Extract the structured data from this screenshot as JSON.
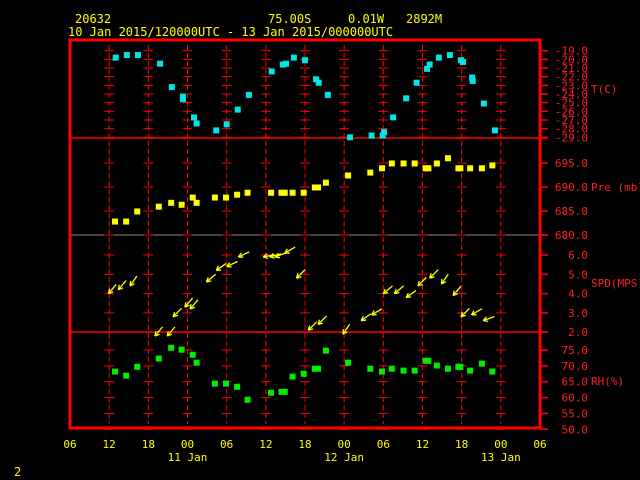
{
  "header": {
    "station": "20632",
    "lat": "75.00S",
    "lon": "0.01W",
    "elev": "2892M",
    "period": "10 Jan 2015/120000UTC - 13 Jan 2015/000000UTC"
  },
  "footer_label": "2",
  "colors": {
    "frame": "#ff0000",
    "text": "#ffff00",
    "temp": "#00e5e5",
    "pres": "#ffff00",
    "wind": "#ffff00",
    "rh": "#00ee00",
    "axis_label": "#ff2020"
  },
  "chart_data": {
    "type": "scatter",
    "x_unit": "hours since 10 Jan 2015 06 UTC",
    "xlim": [
      0,
      72
    ],
    "x_ticks": [
      {
        "h": 0,
        "label": "06"
      },
      {
        "h": 6,
        "label": "12"
      },
      {
        "h": 12,
        "label": "18"
      },
      {
        "h": 18,
        "label": "00"
      },
      {
        "h": 24,
        "label": "06"
      },
      {
        "h": 30,
        "label": "12"
      },
      {
        "h": 36,
        "label": "18"
      },
      {
        "h": 42,
        "label": "00"
      },
      {
        "h": 48,
        "label": "06"
      },
      {
        "h": 54,
        "label": "12"
      },
      {
        "h": 60,
        "label": "18"
      },
      {
        "h": 66,
        "label": "00"
      },
      {
        "h": 72,
        "label": "06"
      }
    ],
    "date_labels": [
      {
        "h": 18,
        "label": "11 Jan"
      },
      {
        "h": 42,
        "label": "12 Jan"
      },
      {
        "h": 66,
        "label": "13 Jan"
      }
    ],
    "panels": [
      {
        "name": "temperature",
        "label": "T(C)",
        "ylim": [
          -29,
          -19
        ],
        "ticks": [
          {
            "v": -19,
            "label": "-19.0"
          },
          {
            "v": -20,
            "label": "-20.0"
          },
          {
            "v": -21,
            "label": "-21.0"
          },
          {
            "v": -22,
            "label": "-22.0"
          },
          {
            "v": -23,
            "label": "-23.0"
          },
          {
            "v": -24,
            "label": "-24.0"
          },
          {
            "v": -25,
            "label": "-25.0"
          },
          {
            "v": -26,
            "label": "-26.0"
          },
          {
            "v": -27,
            "label": "-27.0"
          },
          {
            "v": -28,
            "label": "-28.0"
          },
          {
            "v": -29,
            "label": "-29.0"
          }
        ],
        "points": [
          [
            7.0,
            -19.8
          ],
          [
            8.7,
            -19.5
          ],
          [
            10.4,
            -19.5
          ],
          [
            13.8,
            -20.5
          ],
          [
            15.6,
            -23.2
          ],
          [
            17.3,
            -24.3
          ],
          [
            17.3,
            -24.6
          ],
          [
            19.0,
            -26.7
          ],
          [
            19.4,
            -27.4
          ],
          [
            22.4,
            -28.2
          ],
          [
            24.0,
            -27.5
          ],
          [
            25.7,
            -25.8
          ],
          [
            27.4,
            -24.1
          ],
          [
            30.9,
            -21.4
          ],
          [
            32.6,
            -20.6
          ],
          [
            33.1,
            -20.5
          ],
          [
            34.3,
            -19.8
          ],
          [
            36.0,
            -20.1
          ],
          [
            37.7,
            -22.3
          ],
          [
            38.1,
            -22.7
          ],
          [
            39.5,
            -24.1
          ],
          [
            42.9,
            -29.0
          ],
          [
            46.2,
            -28.8
          ],
          [
            47.9,
            -28.8
          ],
          [
            48.1,
            -28.4
          ],
          [
            49.5,
            -26.7
          ],
          [
            51.5,
            -24.5
          ],
          [
            53.1,
            -22.7
          ],
          [
            54.7,
            -21.1
          ],
          [
            55.1,
            -20.6
          ],
          [
            56.5,
            -19.8
          ],
          [
            58.2,
            -19.5
          ],
          [
            59.9,
            -20.1
          ],
          [
            60.2,
            -20.3
          ],
          [
            61.6,
            -22.1
          ],
          [
            61.7,
            -22.5
          ],
          [
            63.4,
            -25.1
          ],
          [
            65.1,
            -28.2
          ]
        ]
      },
      {
        "name": "pressure",
        "label": "Pre (mb)",
        "ylim": [
          680,
          697
        ],
        "ticks": [
          {
            "v": 695,
            "label": "695.0"
          },
          {
            "v": 690,
            "label": "690.0"
          },
          {
            "v": 685,
            "label": "685.0"
          },
          {
            "v": 680,
            "label": "680.0"
          }
        ],
        "points": [
          [
            6.9,
            682.8
          ],
          [
            8.6,
            682.8
          ],
          [
            10.3,
            684.9
          ],
          [
            13.6,
            685.9
          ],
          [
            15.5,
            686.7
          ],
          [
            17.1,
            686.3
          ],
          [
            18.8,
            687.8
          ],
          [
            19.4,
            686.7
          ],
          [
            22.2,
            687.8
          ],
          [
            23.9,
            687.8
          ],
          [
            25.6,
            688.4
          ],
          [
            27.2,
            688.8
          ],
          [
            30.8,
            688.8
          ],
          [
            32.4,
            688.8
          ],
          [
            32.9,
            688.8
          ],
          [
            34.1,
            688.8
          ],
          [
            35.8,
            688.8
          ],
          [
            37.5,
            689.9
          ],
          [
            38.0,
            689.9
          ],
          [
            39.2,
            690.9
          ],
          [
            42.6,
            692.4
          ],
          [
            46.0,
            693.0
          ],
          [
            47.8,
            693.9
          ],
          [
            49.3,
            694.9
          ],
          [
            51.1,
            694.9
          ],
          [
            52.8,
            694.9
          ],
          [
            54.5,
            693.9
          ],
          [
            54.9,
            693.9
          ],
          [
            56.2,
            694.9
          ],
          [
            57.9,
            696.0
          ],
          [
            59.5,
            693.9
          ],
          [
            59.8,
            693.9
          ],
          [
            61.3,
            693.9
          ],
          [
            63.1,
            693.9
          ],
          [
            64.7,
            694.5
          ]
        ]
      },
      {
        "name": "wind_speed",
        "label": "SPD(MPS)",
        "ylim": [
          2,
          6
        ],
        "ticks": [
          {
            "v": 6,
            "label": "6.0"
          },
          {
            "v": 5,
            "label": "5.0"
          },
          {
            "v": 4,
            "label": "4.0"
          },
          {
            "v": 3,
            "label": "3.0"
          },
          {
            "v": 2,
            "label": "2.0"
          }
        ],
        "points": [
          [
            5.9,
            4.0
          ],
          [
            7.4,
            4.2
          ],
          [
            9.2,
            4.4
          ],
          [
            13.0,
            1.8
          ],
          [
            14.9,
            1.8
          ],
          [
            15.8,
            2.8
          ],
          [
            17.6,
            3.3
          ],
          [
            18.4,
            3.2
          ],
          [
            20.9,
            4.6
          ],
          [
            22.4,
            5.2
          ],
          [
            24.0,
            5.4
          ],
          [
            25.8,
            5.9
          ],
          [
            29.6,
            5.9
          ],
          [
            30.6,
            5.9
          ],
          [
            31.4,
            5.9
          ],
          [
            32.9,
            6.1
          ],
          [
            34.7,
            4.8
          ],
          [
            36.5,
            2.1
          ],
          [
            38.0,
            2.4
          ],
          [
            41.8,
            1.9
          ],
          [
            44.6,
            2.6
          ],
          [
            46.2,
            2.9
          ],
          [
            48.0,
            4.0
          ],
          [
            49.7,
            4.0
          ],
          [
            51.5,
            3.8
          ],
          [
            53.3,
            4.4
          ],
          [
            55.1,
            4.8
          ],
          [
            56.9,
            4.5
          ],
          [
            58.7,
            3.9
          ],
          [
            59.9,
            2.8
          ],
          [
            61.5,
            2.9
          ],
          [
            63.3,
            2.6
          ]
        ],
        "direction_from_deg": [
          40,
          40,
          35,
          40,
          40,
          45,
          40,
          40,
          50,
          55,
          65,
          65,
          80,
          75,
          70,
          60,
          45,
          45,
          45,
          35,
          55,
          60,
          50,
          50,
          55,
          45,
          45,
          35,
          40,
          45,
          60,
          70
        ]
      },
      {
        "name": "relative_humidity",
        "label": "RH(%)",
        "ylim": [
          50,
          75
        ],
        "ticks": [
          {
            "v": 75,
            "label": "75.0"
          },
          {
            "v": 70,
            "label": "70.0"
          },
          {
            "v": 65,
            "label": "65.0"
          },
          {
            "v": 60,
            "label": "60.0"
          },
          {
            "v": 55,
            "label": "55.0"
          },
          {
            "v": 50,
            "label": "50.0"
          }
        ],
        "points": [
          [
            6.9,
            68.2
          ],
          [
            8.6,
            66.9
          ],
          [
            10.3,
            69.7
          ],
          [
            13.6,
            72.3
          ],
          [
            15.5,
            75.7
          ],
          [
            17.1,
            75.1
          ],
          [
            18.8,
            73.5
          ],
          [
            19.4,
            71.0
          ],
          [
            22.2,
            64.4
          ],
          [
            23.9,
            64.4
          ],
          [
            25.6,
            63.4
          ],
          [
            27.2,
            59.3
          ],
          [
            30.8,
            61.5
          ],
          [
            32.4,
            61.8
          ],
          [
            32.9,
            61.8
          ],
          [
            34.1,
            66.6
          ],
          [
            35.8,
            67.5
          ],
          [
            37.5,
            69.1
          ],
          [
            38.0,
            69.1
          ],
          [
            39.2,
            74.8
          ],
          [
            42.6,
            71.0
          ],
          [
            46.0,
            69.1
          ],
          [
            47.8,
            68.2
          ],
          [
            49.3,
            69.1
          ],
          [
            51.1,
            68.5
          ],
          [
            52.8,
            68.5
          ],
          [
            54.5,
            71.6
          ],
          [
            54.9,
            71.6
          ],
          [
            56.2,
            70.1
          ],
          [
            57.9,
            69.1
          ],
          [
            59.5,
            69.7
          ],
          [
            59.8,
            69.7
          ],
          [
            61.3,
            68.5
          ],
          [
            63.1,
            70.7
          ],
          [
            64.7,
            68.2
          ]
        ]
      }
    ]
  }
}
